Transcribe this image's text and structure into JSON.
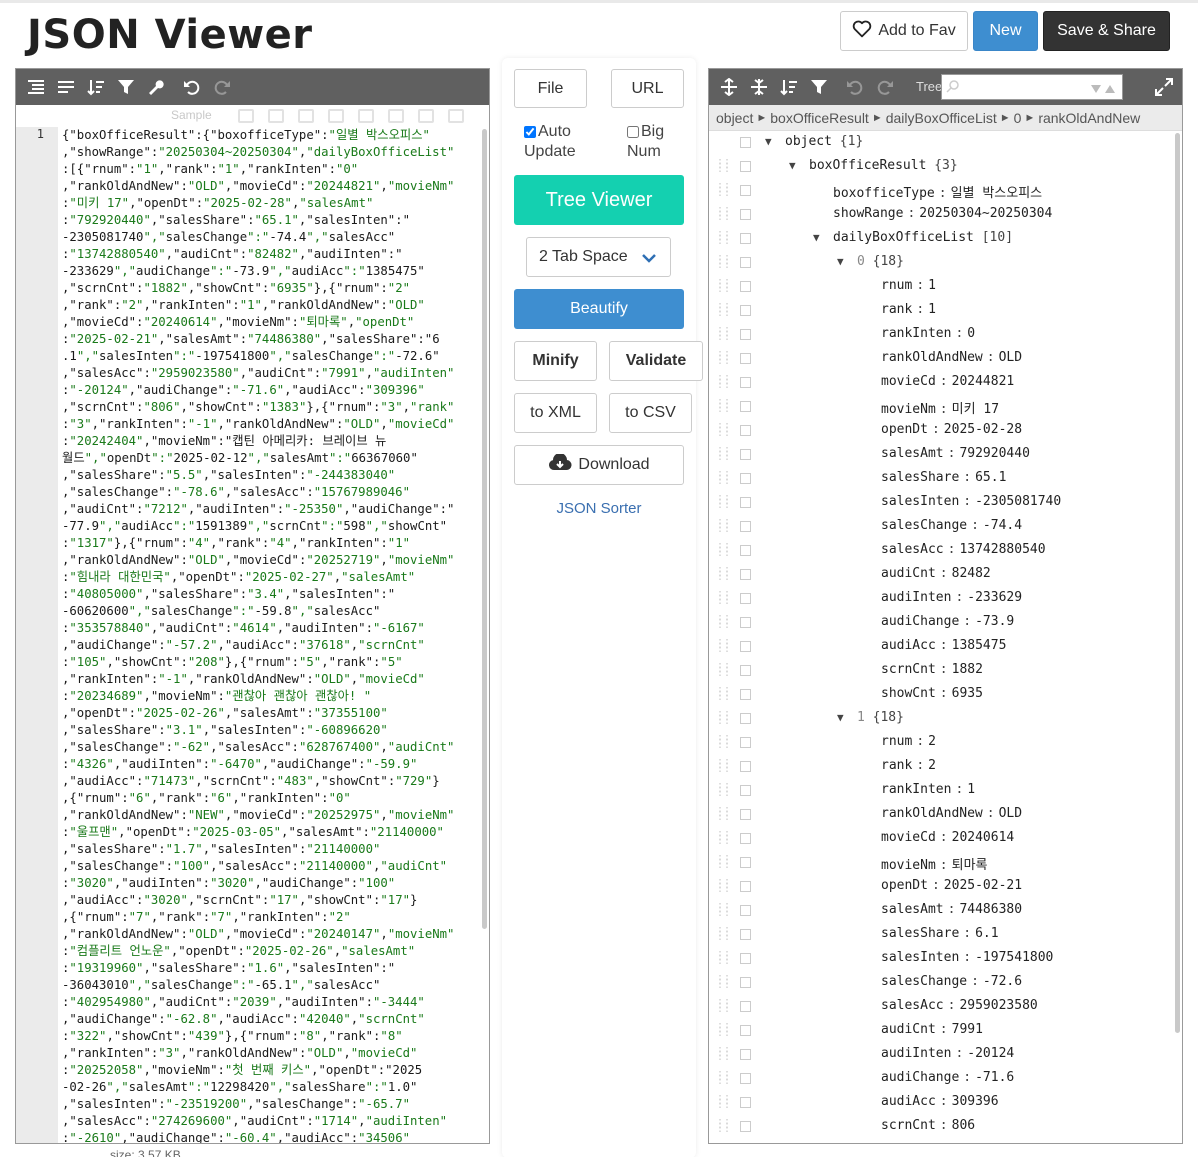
{
  "header": {
    "title": "JSON Viewer",
    "fav_label": "Add to Fav",
    "new_label": "New",
    "save_label": "Save & Share"
  },
  "editor": {
    "ghost_label": "Sample",
    "line_number": "1",
    "size_label": "size: 3.57 KB",
    "code_lines": [
      "{\"boxOfficeResult\":{\"boxofficeType\":\"일별 박스오피스\"",
      ",\"showRange\":\"20250304~20250304\",\"dailyBoxOfficeList\"",
      ":[{\"rnum\":\"1\",\"rank\":\"1\",\"rankInten\":\"0\"",
      ",\"rankOldAndNew\":\"OLD\",\"movieCd\":\"20244821\",\"movieNm\"",
      ":\"미키 17\",\"openDt\":\"2025-02-28\",\"salesAmt\"",
      ":\"792920440\",\"salesShare\":\"65.1\",\"salesInten\":\"",
      "-2305081740\",\"salesChange\":\"-74.4\",\"salesAcc\"",
      ":\"13742880540\",\"audiCnt\":\"82482\",\"audiInten\":\"",
      "-233629\",\"audiChange\":\"-73.9\",\"audiAcc\":\"1385475\"",
      ",\"scrnCnt\":\"1882\",\"showCnt\":\"6935\"},{\"rnum\":\"2\"",
      ",\"rank\":\"2\",\"rankInten\":\"1\",\"rankOldAndNew\":\"OLD\"",
      ",\"movieCd\":\"20240614\",\"movieNm\":\"퇴마록\",\"openDt\"",
      ":\"2025-02-21\",\"salesAmt\":\"74486380\",\"salesShare\":\"6",
      ".1\",\"salesInten\":\"-197541800\",\"salesChange\":\"-72.6\"",
      ",\"salesAcc\":\"2959023580\",\"audiCnt\":\"7991\",\"audiInten\"",
      ":\"-20124\",\"audiChange\":\"-71.6\",\"audiAcc\":\"309396\"",
      ",\"scrnCnt\":\"806\",\"showCnt\":\"1383\"},{\"rnum\":\"3\",\"rank\"",
      ":\"3\",\"rankInten\":\"-1\",\"rankOldAndNew\":\"OLD\",\"movieCd\"",
      ":\"20242404\",\"movieNm\":\"캡틴 아메리카: 브레이브 뉴",
      "월드\",\"openDt\":\"2025-02-12\",\"salesAmt\":\"66367060\"",
      ",\"salesShare\":\"5.5\",\"salesInten\":\"-244383040\"",
      ",\"salesChange\":\"-78.6\",\"salesAcc\":\"15767989046\"",
      ",\"audiCnt\":\"7212\",\"audiInten\":\"-25350\",\"audiChange\":\"",
      "-77.9\",\"audiAcc\":\"1591389\",\"scrnCnt\":\"598\",\"showCnt\"",
      ":\"1317\"},{\"rnum\":\"4\",\"rank\":\"4\",\"rankInten\":\"1\"",
      ",\"rankOldAndNew\":\"OLD\",\"movieCd\":\"20252719\",\"movieNm\"",
      ":\"힘내라 대한민국\",\"openDt\":\"2025-02-27\",\"salesAmt\"",
      ":\"40805000\",\"salesShare\":\"3.4\",\"salesInten\":\"",
      "-60620600\",\"salesChange\":\"-59.8\",\"salesAcc\"",
      ":\"353578840\",\"audiCnt\":\"4614\",\"audiInten\":\"-6167\"",
      ",\"audiChange\":\"-57.2\",\"audiAcc\":\"37618\",\"scrnCnt\"",
      ":\"105\",\"showCnt\":\"208\"},{\"rnum\":\"5\",\"rank\":\"5\"",
      ",\"rankInten\":\"-1\",\"rankOldAndNew\":\"OLD\",\"movieCd\"",
      ":\"20234689\",\"movieNm\":\"괜찮아 괜찮아 괜찮아! \"",
      ",\"openDt\":\"2025-02-26\",\"salesAmt\":\"37355100\"",
      ",\"salesShare\":\"3.1\",\"salesInten\":\"-60896620\"",
      ",\"salesChange\":\"-62\",\"salesAcc\":\"628767400\",\"audiCnt\"",
      ":\"4326\",\"audiInten\":\"-6470\",\"audiChange\":\"-59.9\"",
      ",\"audiAcc\":\"71473\",\"scrnCnt\":\"483\",\"showCnt\":\"729\"}",
      ",{\"rnum\":\"6\",\"rank\":\"6\",\"rankInten\":\"0\"",
      ",\"rankOldAndNew\":\"NEW\",\"movieCd\":\"20252975\",\"movieNm\"",
      ":\"울프맨\",\"openDt\":\"2025-03-05\",\"salesAmt\":\"21140000\"",
      ",\"salesShare\":\"1.7\",\"salesInten\":\"21140000\"",
      ",\"salesChange\":\"100\",\"salesAcc\":\"21140000\",\"audiCnt\"",
      ":\"3020\",\"audiInten\":\"3020\",\"audiChange\":\"100\"",
      ",\"audiAcc\":\"3020\",\"scrnCnt\":\"17\",\"showCnt\":\"17\"}",
      ",{\"rnum\":\"7\",\"rank\":\"7\",\"rankInten\":\"2\"",
      ",\"rankOldAndNew\":\"OLD\",\"movieCd\":\"20240147\",\"movieNm\"",
      ":\"컴플리트 언노운\",\"openDt\":\"2025-02-26\",\"salesAmt\"",
      ":\"19319960\",\"salesShare\":\"1.6\",\"salesInten\":\"",
      "-36043010\",\"salesChange\":\"-65.1\",\"salesAcc\"",
      ":\"402954980\",\"audiCnt\":\"2039\",\"audiInten\":\"-3444\"",
      ",\"audiChange\":\"-62.8\",\"audiAcc\":\"42040\",\"scrnCnt\"",
      ":\"322\",\"showCnt\":\"439\"},{\"rnum\":\"8\",\"rank\":\"8\"",
      ",\"rankInten\":\"3\",\"rankOldAndNew\":\"OLD\",\"movieCd\"",
      ":\"20252058\",\"movieNm\":\"첫 번째 키스\",\"openDt\":\"2025",
      "-02-26\",\"salesAmt\":\"12298420\",\"salesShare\":\"1.0\"",
      ",\"salesInten\":\"-23519200\",\"salesChange\":\"-65.7\"",
      ",\"salesAcc\":\"274269600\",\"audiCnt\":\"1714\",\"audiInten\"",
      ":\"-2610\",\"audiChange\":\"-60.4\",\"audiAcc\":\"34506\""
    ]
  },
  "middle": {
    "file_label": "File",
    "url_label": "URL",
    "auto_update_label": "Auto\nUpdate",
    "big_num_label": "Big\nNum",
    "tree_viewer_label": "Tree Viewer",
    "tab_space_value": "2 Tab Space",
    "beautify_label": "Beautify",
    "minify_label": "Minify",
    "validate_label": "Validate",
    "to_xml_label": "to XML",
    "to_csv_label": "to CSV",
    "download_label": "Download",
    "sorter_label": "JSON Sorter"
  },
  "tree": {
    "toolbar_label": "Tree",
    "breadcrumb": [
      "object",
      "boxOfficeResult",
      "dailyBoxOfficeList",
      "0",
      "rankOldAndNew"
    ],
    "nodes": [
      {
        "depth": 0,
        "toggle": "▼",
        "key": "object",
        "meta": "{1}"
      },
      {
        "depth": 1,
        "toggle": "▼",
        "key": "boxOfficeResult",
        "meta": "{3}"
      },
      {
        "depth": 2,
        "key": "boxofficeType",
        "value": "일별 박스오피스"
      },
      {
        "depth": 2,
        "key": "showRange",
        "value": "20250304~20250304"
      },
      {
        "depth": 2,
        "toggle": "▼",
        "key": "dailyBoxOfficeList",
        "meta": "[10]"
      },
      {
        "depth": 3,
        "toggle": "▼",
        "index": "0",
        "meta": "{18}"
      },
      {
        "depth": 4,
        "key": "rnum",
        "value": "1"
      },
      {
        "depth": 4,
        "key": "rank",
        "value": "1"
      },
      {
        "depth": 4,
        "key": "rankInten",
        "value": "0"
      },
      {
        "depth": 4,
        "key": "rankOldAndNew",
        "value": "OLD"
      },
      {
        "depth": 4,
        "key": "movieCd",
        "value": "20244821"
      },
      {
        "depth": 4,
        "key": "movieNm",
        "value": "미키 17"
      },
      {
        "depth": 4,
        "key": "openDt",
        "value": "2025-02-28"
      },
      {
        "depth": 4,
        "key": "salesAmt",
        "value": "792920440"
      },
      {
        "depth": 4,
        "key": "salesShare",
        "value": "65.1"
      },
      {
        "depth": 4,
        "key": "salesInten",
        "value": "-2305081740"
      },
      {
        "depth": 4,
        "key": "salesChange",
        "value": "-74.4"
      },
      {
        "depth": 4,
        "key": "salesAcc",
        "value": "13742880540"
      },
      {
        "depth": 4,
        "key": "audiCnt",
        "value": "82482"
      },
      {
        "depth": 4,
        "key": "audiInten",
        "value": "-233629"
      },
      {
        "depth": 4,
        "key": "audiChange",
        "value": "-73.9"
      },
      {
        "depth": 4,
        "key": "audiAcc",
        "value": "1385475"
      },
      {
        "depth": 4,
        "key": "scrnCnt",
        "value": "1882"
      },
      {
        "depth": 4,
        "key": "showCnt",
        "value": "6935"
      },
      {
        "depth": 3,
        "toggle": "▼",
        "index": "1",
        "meta": "{18}"
      },
      {
        "depth": 4,
        "key": "rnum",
        "value": "2"
      },
      {
        "depth": 4,
        "key": "rank",
        "value": "2"
      },
      {
        "depth": 4,
        "key": "rankInten",
        "value": "1"
      },
      {
        "depth": 4,
        "key": "rankOldAndNew",
        "value": "OLD"
      },
      {
        "depth": 4,
        "key": "movieCd",
        "value": "20240614"
      },
      {
        "depth": 4,
        "key": "movieNm",
        "value": "퇴마록"
      },
      {
        "depth": 4,
        "key": "openDt",
        "value": "2025-02-21"
      },
      {
        "depth": 4,
        "key": "salesAmt",
        "value": "74486380"
      },
      {
        "depth": 4,
        "key": "salesShare",
        "value": "6.1"
      },
      {
        "depth": 4,
        "key": "salesInten",
        "value": "-197541800"
      },
      {
        "depth": 4,
        "key": "salesChange",
        "value": "-72.6"
      },
      {
        "depth": 4,
        "key": "salesAcc",
        "value": "2959023580"
      },
      {
        "depth": 4,
        "key": "audiCnt",
        "value": "7991"
      },
      {
        "depth": 4,
        "key": "audiInten",
        "value": "-20124"
      },
      {
        "depth": 4,
        "key": "audiChange",
        "value": "-71.6"
      },
      {
        "depth": 4,
        "key": "audiAcc",
        "value": "309396"
      },
      {
        "depth": 4,
        "key": "scrnCnt",
        "value": "806"
      }
    ]
  },
  "colors": {
    "toolbar_bg": "#606060",
    "accent_blue": "#3e8ed0",
    "tree_viewer_teal": "#14d0b0",
    "string_green": "#1a7a1a"
  }
}
